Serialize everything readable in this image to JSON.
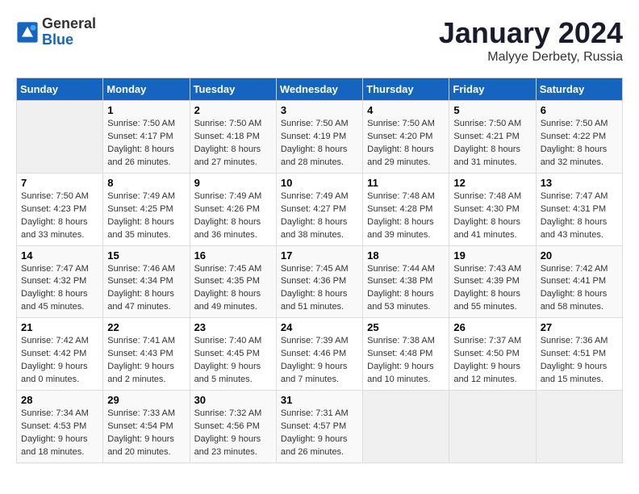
{
  "header": {
    "logo_line1": "General",
    "logo_line2": "Blue",
    "month": "January 2024",
    "location": "Malyye Derbety, Russia"
  },
  "weekdays": [
    "Sunday",
    "Monday",
    "Tuesday",
    "Wednesday",
    "Thursday",
    "Friday",
    "Saturday"
  ],
  "weeks": [
    [
      {
        "day": "",
        "info": ""
      },
      {
        "day": "1",
        "info": "Sunrise: 7:50 AM\nSunset: 4:17 PM\nDaylight: 8 hours\nand 26 minutes."
      },
      {
        "day": "2",
        "info": "Sunrise: 7:50 AM\nSunset: 4:18 PM\nDaylight: 8 hours\nand 27 minutes."
      },
      {
        "day": "3",
        "info": "Sunrise: 7:50 AM\nSunset: 4:19 PM\nDaylight: 8 hours\nand 28 minutes."
      },
      {
        "day": "4",
        "info": "Sunrise: 7:50 AM\nSunset: 4:20 PM\nDaylight: 8 hours\nand 29 minutes."
      },
      {
        "day": "5",
        "info": "Sunrise: 7:50 AM\nSunset: 4:21 PM\nDaylight: 8 hours\nand 31 minutes."
      },
      {
        "day": "6",
        "info": "Sunrise: 7:50 AM\nSunset: 4:22 PM\nDaylight: 8 hours\nand 32 minutes."
      }
    ],
    [
      {
        "day": "7",
        "info": "Sunrise: 7:50 AM\nSunset: 4:23 PM\nDaylight: 8 hours\nand 33 minutes."
      },
      {
        "day": "8",
        "info": "Sunrise: 7:49 AM\nSunset: 4:25 PM\nDaylight: 8 hours\nand 35 minutes."
      },
      {
        "day": "9",
        "info": "Sunrise: 7:49 AM\nSunset: 4:26 PM\nDaylight: 8 hours\nand 36 minutes."
      },
      {
        "day": "10",
        "info": "Sunrise: 7:49 AM\nSunset: 4:27 PM\nDaylight: 8 hours\nand 38 minutes."
      },
      {
        "day": "11",
        "info": "Sunrise: 7:48 AM\nSunset: 4:28 PM\nDaylight: 8 hours\nand 39 minutes."
      },
      {
        "day": "12",
        "info": "Sunrise: 7:48 AM\nSunset: 4:30 PM\nDaylight: 8 hours\nand 41 minutes."
      },
      {
        "day": "13",
        "info": "Sunrise: 7:47 AM\nSunset: 4:31 PM\nDaylight: 8 hours\nand 43 minutes."
      }
    ],
    [
      {
        "day": "14",
        "info": "Sunrise: 7:47 AM\nSunset: 4:32 PM\nDaylight: 8 hours\nand 45 minutes."
      },
      {
        "day": "15",
        "info": "Sunrise: 7:46 AM\nSunset: 4:34 PM\nDaylight: 8 hours\nand 47 minutes."
      },
      {
        "day": "16",
        "info": "Sunrise: 7:45 AM\nSunset: 4:35 PM\nDaylight: 8 hours\nand 49 minutes."
      },
      {
        "day": "17",
        "info": "Sunrise: 7:45 AM\nSunset: 4:36 PM\nDaylight: 8 hours\nand 51 minutes."
      },
      {
        "day": "18",
        "info": "Sunrise: 7:44 AM\nSunset: 4:38 PM\nDaylight: 8 hours\nand 53 minutes."
      },
      {
        "day": "19",
        "info": "Sunrise: 7:43 AM\nSunset: 4:39 PM\nDaylight: 8 hours\nand 55 minutes."
      },
      {
        "day": "20",
        "info": "Sunrise: 7:42 AM\nSunset: 4:41 PM\nDaylight: 8 hours\nand 58 minutes."
      }
    ],
    [
      {
        "day": "21",
        "info": "Sunrise: 7:42 AM\nSunset: 4:42 PM\nDaylight: 9 hours\nand 0 minutes."
      },
      {
        "day": "22",
        "info": "Sunrise: 7:41 AM\nSunset: 4:43 PM\nDaylight: 9 hours\nand 2 minutes."
      },
      {
        "day": "23",
        "info": "Sunrise: 7:40 AM\nSunset: 4:45 PM\nDaylight: 9 hours\nand 5 minutes."
      },
      {
        "day": "24",
        "info": "Sunrise: 7:39 AM\nSunset: 4:46 PM\nDaylight: 9 hours\nand 7 minutes."
      },
      {
        "day": "25",
        "info": "Sunrise: 7:38 AM\nSunset: 4:48 PM\nDaylight: 9 hours\nand 10 minutes."
      },
      {
        "day": "26",
        "info": "Sunrise: 7:37 AM\nSunset: 4:50 PM\nDaylight: 9 hours\nand 12 minutes."
      },
      {
        "day": "27",
        "info": "Sunrise: 7:36 AM\nSunset: 4:51 PM\nDaylight: 9 hours\nand 15 minutes."
      }
    ],
    [
      {
        "day": "28",
        "info": "Sunrise: 7:34 AM\nSunset: 4:53 PM\nDaylight: 9 hours\nand 18 minutes."
      },
      {
        "day": "29",
        "info": "Sunrise: 7:33 AM\nSunset: 4:54 PM\nDaylight: 9 hours\nand 20 minutes."
      },
      {
        "day": "30",
        "info": "Sunrise: 7:32 AM\nSunset: 4:56 PM\nDaylight: 9 hours\nand 23 minutes."
      },
      {
        "day": "31",
        "info": "Sunrise: 7:31 AM\nSunset: 4:57 PM\nDaylight: 9 hours\nand 26 minutes."
      },
      {
        "day": "",
        "info": ""
      },
      {
        "day": "",
        "info": ""
      },
      {
        "day": "",
        "info": ""
      }
    ]
  ]
}
